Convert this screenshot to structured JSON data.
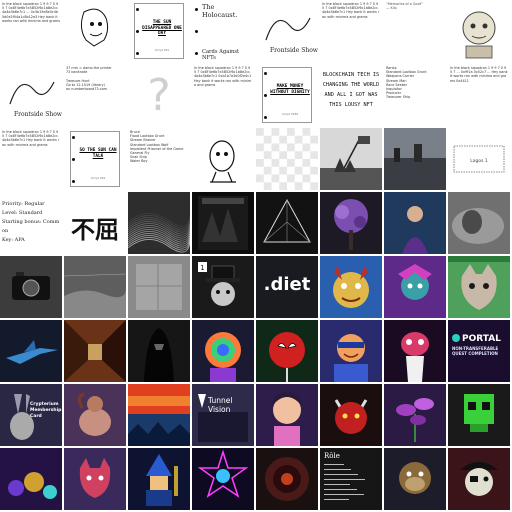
{
  "tiles": [
    {
      "kind": "text",
      "bg": "#ffffff",
      "fg": "#333333",
      "text": "In the black squadron 1 9 9 7 0 9 5 7  0x8F4e6b7e3B52f6c1b8e2cc4a4a3b6e7c1 ... 0x3b15e8e0c4b5d0e2f04a1c8b12e3 Hey bank it works ran with minima and grams"
    },
    {
      "kind": "svg",
      "bg": "#ffffff",
      "icon": "line-art-face-icon"
    },
    {
      "kind": "card",
      "bg": "#ffffff",
      "title": "THE SUN DISAPPEARED ONE DAY",
      "footer": "Script 001"
    },
    {
      "kind": "hash",
      "bg": "#ffffff",
      "title": "The Holocaust.",
      "subtitle": "Cards Against NFTs"
    },
    {
      "kind": "svg",
      "bg": "#ffffff",
      "icon": "frontside-show-logo-icon",
      "label": "Frontside Show #2"
    },
    {
      "kind": "text",
      "bg": "#ffffff",
      "fg": "#333333",
      "text": "In the black squadron 1 9 9 7 0 9 5 7  0x8F4e6b7e3B52f6c1b8e2cc4a4a3b6e7c1 Hey bank it works ran with minima and grams"
    },
    {
      "kind": "text",
      "bg": "#ffffff",
      "fg": "#555555",
      "text": "“Memories of a Goat”\n        — Kilo"
    },
    {
      "kind": "svg",
      "bg": "#ffffff",
      "icon": "sketch-ape-icon"
    },
    {
      "kind": "svg",
      "bg": "#ffffff",
      "icon": "frontside-show-logo-icon",
      "label": "Frontside Show #3"
    },
    {
      "kind": "text",
      "bg": "#ffffff",
      "fg": "#333333",
      "text": "37 mm  ≈ damo the printer\n73 banknote\n\nTreasure Hunt\nGo to 12.1019 (library)\non numberboard73.com"
    },
    {
      "kind": "svg",
      "bg": "#ffffff",
      "icon": "question-mark-icon"
    },
    {
      "kind": "text",
      "bg": "#ffffff",
      "fg": "#333333",
      "text": "In the black squadron 1 9 9 7 0 9 5 7  0x8F4e6b7e3B52f6c1b8e2cc4a4a3b6e7c1 0xb1b7a3d0f2e4c1 Hey bank it works ran with minima and grams"
    },
    {
      "kind": "card",
      "bg": "#ffffff",
      "title": "MAKE MONEY WITHOUT DIGNITY",
      "footer": "Script 0038"
    },
    {
      "kind": "banner",
      "bg": "#ffffff",
      "text": "BLOCKCHAIN TECH IS CHANGING THE WORLD AND ALL I GOT WAS THIS LOUSY NFT"
    },
    {
      "kind": "text",
      "bg": "#ffffff",
      "fg": "#333333",
      "text": "Ranks:\nStandard Lootbox Grunt\nWeapons Carrier\nStream Man\nRace Seeker\nInquisitor\nProducer\nTreasurer Ship"
    },
    {
      "kind": "text",
      "bg": "#ffffff",
      "fg": "#333333",
      "text": "In the black squadron 1 9 9 7 0 9 5 7 ... 0x9f1a 0x52c7 ... Hey bank it works ran with minima and grams 0x4411"
    },
    {
      "kind": "text",
      "bg": "#ffffff",
      "fg": "#333333",
      "text": "In the black squadron 1 9 9 7 0 9 5 7  0x8F4e6b7e3B52f6c1b8e2cc4a4a3b6e7c1 Hey bank it works ran with minima and grams"
    },
    {
      "kind": "card",
      "bg": "#ffffff",
      "title": "SO THE SUN CAN TALK",
      "footer": "Script 004"
    },
    {
      "kind": "text",
      "bg": "#ffffff",
      "fg": "#333333",
      "text": "Bruce\nFlood Lootbox Grunt\nStream Brainer\nStandard Lootbox Wolf\nImpatient Prisoner of the Game\nGeneral Fly\nSnail Ship\nWater Boy"
    },
    {
      "kind": "svg",
      "bg": "#ffffff",
      "icon": "robot-character-icon"
    },
    {
      "kind": "svg",
      "bg": "#ffffff",
      "icon": "checkerboard-icon"
    },
    {
      "kind": "svg",
      "bg": "#d8d8d8",
      "icon": "flag-raising-photo-icon"
    },
    {
      "kind": "svg",
      "bg": "#5a5e66",
      "icon": "harbor-photo-icon"
    },
    {
      "kind": "svg",
      "bg": "#ffffff",
      "icon": "ticket-outline-icon",
      "label": "Lagos 1"
    },
    {
      "kind": "text",
      "bg": "#ffffff",
      "fg": "#222222",
      "serif": true,
      "text": "Priority: Regular\nLevel: Standard\nStarting bonus: Common\nKey: APA"
    },
    {
      "kind": "svg",
      "bg": "#ffffff",
      "icon": "ink-calligraphy-icon",
      "label": "不屈"
    },
    {
      "kind": "svg",
      "bg": "#2d2d2d",
      "icon": "wave-landscape-icon"
    },
    {
      "kind": "svg",
      "bg": "#0b0b0b",
      "icon": "dark-poster-icon"
    },
    {
      "kind": "svg",
      "bg": "#121212",
      "icon": "triangle-geometry-icon"
    },
    {
      "kind": "svg",
      "bg": "#1d1a26",
      "icon": "purple-tree-icon"
    },
    {
      "kind": "svg",
      "bg": "#182436",
      "icon": "figure-in-blue-icon"
    },
    {
      "kind": "svg",
      "bg": "#707070",
      "icon": "misty-scene-icon"
    },
    {
      "kind": "svg",
      "bg": "#3c3c3c",
      "icon": "camera-photo-icon"
    },
    {
      "kind": "svg",
      "bg": "#5e5e5e",
      "icon": "desert-photo-icon"
    },
    {
      "kind": "svg",
      "bg": "#8a8a8a",
      "icon": "concrete-photo-icon"
    },
    {
      "kind": "svg",
      "bg": "#1a1a1a",
      "icon": "top-hat-character-icon",
      "badge": "1"
    },
    {
      "kind": "logo",
      "bg": "#1a1b20",
      "text": ".diet"
    },
    {
      "kind": "svg",
      "bg": "#2a5fb0",
      "icon": "dragon-character-icon"
    },
    {
      "kind": "svg",
      "bg": "#5e2a8a",
      "icon": "jester-character-icon"
    },
    {
      "kind": "svg",
      "bg": "#4ea05a",
      "icon": "wolf-character-icon"
    },
    {
      "kind": "svg",
      "bg": "#131a2b",
      "icon": "blue-fighter-jet-icon"
    },
    {
      "kind": "svg",
      "bg": "#6a3318",
      "icon": "corridor-photo-icon"
    },
    {
      "kind": "svg",
      "bg": "#161616",
      "icon": "robed-figure-icon"
    },
    {
      "kind": "svg",
      "bg": "#1a1a33",
      "icon": "rainbow-astronaut-icon"
    },
    {
      "kind": "svg",
      "bg": "#102818",
      "icon": "spider-hero-lollipop-icon"
    },
    {
      "kind": "svg",
      "bg": "#2a2a6e",
      "icon": "smiling-avatar-icon"
    },
    {
      "kind": "svg",
      "bg": "#1a0a22",
      "icon": "alien-character-icon"
    },
    {
      "kind": "portal",
      "bg": "#1b0d2d",
      "title": "PORTAL",
      "subtitle": "NON-TRANSFERABLE QUEST COMPLETION"
    },
    {
      "kind": "card-dark",
      "bg": "#2a2745",
      "title": "Crypterium Membership Card"
    },
    {
      "kind": "svg",
      "bg": "#4a3258",
      "icon": "seated-figure-icon"
    },
    {
      "kind": "svg",
      "bg": "#0f0f2a",
      "icon": "pixel-sunset-icon"
    },
    {
      "kind": "tunnel",
      "bg": "#2e2a4a",
      "title": "Tunnel Vision"
    },
    {
      "kind": "svg",
      "bg": "#2e1c4a",
      "icon": "cartoon-girl-icon"
    },
    {
      "kind": "svg",
      "bg": "#1a0e0e",
      "icon": "red-demon-icon"
    },
    {
      "kind": "svg",
      "bg": "#2a1a44",
      "icon": "purple-plant-icon"
    },
    {
      "kind": "svg",
      "bg": "#1a1a1a",
      "icon": "pixel-skull-icon"
    },
    {
      "kind": "svg",
      "bg": "#241244",
      "icon": "neon-crowd-icon"
    },
    {
      "kind": "svg",
      "bg": "#3a2a5c",
      "icon": "pink-cat-icon"
    },
    {
      "kind": "svg",
      "bg": "#0d1330",
      "icon": "pixel-sorcerer-icon"
    },
    {
      "kind": "svg",
      "bg": "#0e0a22",
      "icon": "neon-star-character-icon"
    },
    {
      "kind": "svg",
      "bg": "#1a1010",
      "icon": "dark-vortex-icon"
    },
    {
      "kind": "role",
      "bg": "#161616",
      "title": "Rôle",
      "text": "Ranks list card"
    },
    {
      "kind": "svg",
      "bg": "#1c1c2a",
      "icon": "ape-character-icon"
    },
    {
      "kind": "svg",
      "bg": "#3a1418",
      "icon": "pirate-character-icon"
    }
  ]
}
